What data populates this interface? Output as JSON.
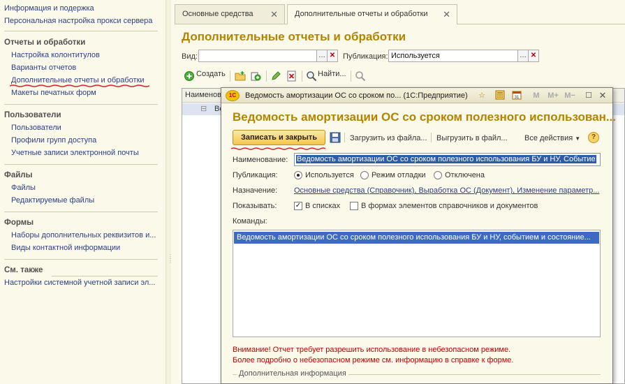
{
  "sidebar": {
    "items": [
      {
        "label": "Информация и подержка"
      },
      {
        "label": "Персональная настройка прокси сервера"
      }
    ],
    "sections": [
      {
        "title": "Отчеты и обработки",
        "items": [
          "Настройка колонтитулов",
          "Варианты отчетов",
          "Дополнительные отчеты и обработки",
          "Макеты печатных форм"
        ]
      },
      {
        "title": "Пользователи",
        "items": [
          "Пользователи",
          "Профили групп доступа",
          "Учетные записи электронной почты"
        ]
      },
      {
        "title": "Файлы",
        "items": [
          "Файлы",
          "Редактируемые файлы"
        ]
      },
      {
        "title": "Формы",
        "items": [
          "Наборы дополнительных реквизитов и...",
          "Виды контактной информации"
        ]
      },
      {
        "title": "См. также",
        "items": [
          "Настройки системной учетной записи эл..."
        ]
      }
    ]
  },
  "tabs": [
    {
      "label": "Основные средства"
    },
    {
      "label": "Дополнительные отчеты и обработки"
    }
  ],
  "list_page": {
    "title": "Дополнительные отчеты и обработки",
    "filter_vid_label": "Вид:",
    "filter_vid_value": "",
    "filter_pub_label": "Публикация:",
    "filter_pub_value": "Используется",
    "create_label": "Создать",
    "find_label": "Найти...",
    "column_name": "Наименование",
    "row_fragment": "Ве"
  },
  "dialog": {
    "window_title": "Ведомость амортизации ОС со сроком по... (1С:Предприятие)",
    "header": "Ведомость амортизации ОС со сроком полезного использован...",
    "save_close": "Записать и закрыть",
    "load_file": "Загрузить из файла...",
    "unload_file": "Выгрузить в файл...",
    "all_actions": "Все действия",
    "name_label": "Наименование:",
    "name_value": "Ведомость амортизации ОС со сроком полезного использования БУ и НУ, Событие",
    "publication_label": "Публикация:",
    "publication_options": [
      "Используется",
      "Режим отладки",
      "Отключена"
    ],
    "publication_selected": "Используется",
    "purpose_label": "Назначение:",
    "purpose_value": "Основные средства (Справочник), Выработка ОС (Документ), Изменение параметр...",
    "show_label": "Показывать:",
    "show_in_lists": "В списках",
    "show_in_lists_checked": true,
    "show_in_forms": "В формах элементов справочников и документов",
    "show_in_forms_checked": false,
    "commands_label": "Команды:",
    "command_row": "Ведомость амортизации ОС со сроком полезного использования БУ и НУ, событием и состояние...",
    "warning_1": "Внимание! Отчет требует разрешить использование в небезопасном режиме.",
    "warning_2": "Более подробно о небезопасном режиме см. информацию в справке к форме.",
    "extra_group": "Дополнительная информация"
  },
  "colors": {
    "accent_title": "#b28400",
    "link": "#2c3e86",
    "warning": "#c00000",
    "selection": "#3d6bc4",
    "background": "#fbf9ea"
  }
}
